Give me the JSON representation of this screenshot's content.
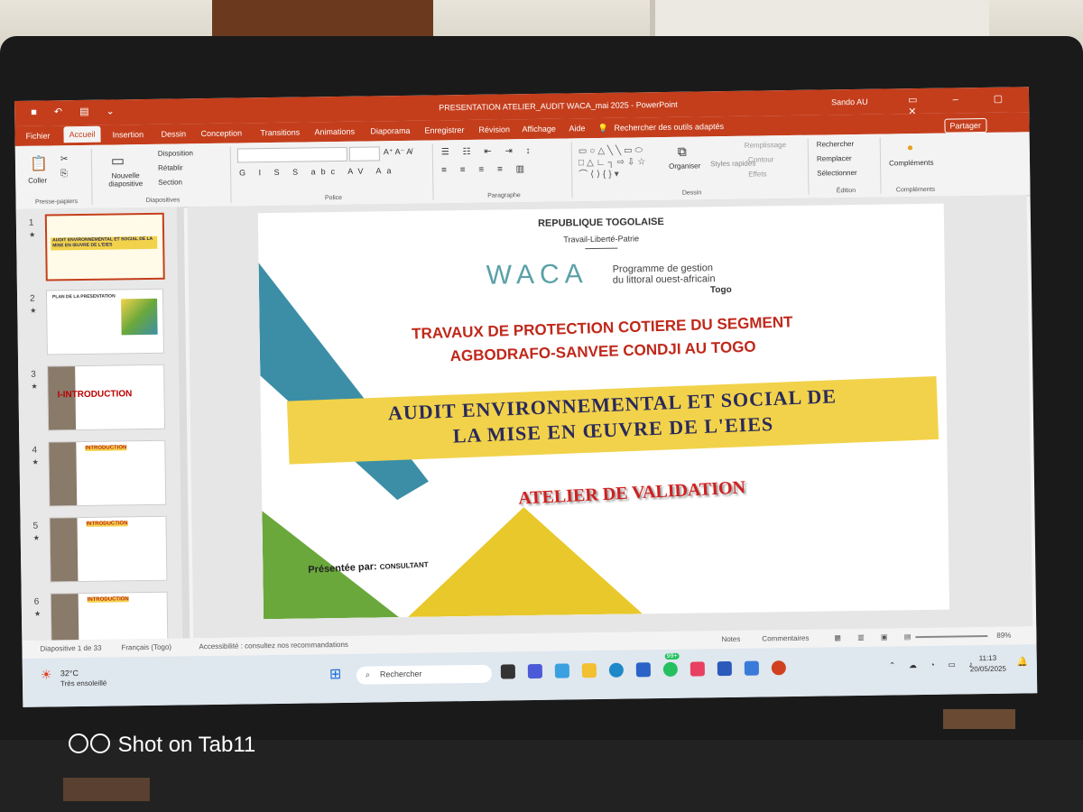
{
  "window": {
    "title": "PRESENTATION ATELIER_AUDIT WACA_mai 2025  -  PowerPoint",
    "user": "Sando AU"
  },
  "menu": {
    "tabs": [
      "Fichier",
      "Accueil",
      "Insertion",
      "Dessin",
      "Conception",
      "Transitions",
      "Animations",
      "Diaporama",
      "Enregistrer",
      "Révision",
      "Affichage",
      "Aide"
    ],
    "search": "Rechercher des outils adaptés",
    "share": "Partager"
  },
  "ribbon": {
    "paste": "Coller",
    "clipboard": "Presse-papiers",
    "new_slide": "Nouvelle diapositive",
    "disposition": "Disposition",
    "retablir": "Rétablir",
    "section": "Section",
    "slides_group": "Diapositives",
    "font_group": "Police",
    "paragraph_group": "Paragraphe",
    "arrange": "Organiser",
    "quick_styles": "Styles rapides",
    "fill": "Remplissage",
    "outline": "Contour",
    "effects": "Effets",
    "drawing_group": "Dessin",
    "find": "Rechercher",
    "replace": "Remplacer",
    "select": "Sélectionner",
    "editing_group": "Édition",
    "addins": "Compléments",
    "addins_group": "Compléments"
  },
  "thumbnails": [
    {
      "num": "1",
      "label": "AUDIT ENVIRONNEMENTAL ET SOCIAL DE LA MISE EN ŒUVRE DE L'EIES"
    },
    {
      "num": "2",
      "label": "PLAN DE LA PRESENTATION"
    },
    {
      "num": "3",
      "label": "I-INTRODUCTION"
    },
    {
      "num": "4",
      "label": "INTRODUCTION"
    },
    {
      "num": "5",
      "label": "INTRODUCTION"
    },
    {
      "num": "6",
      "label": "INTRODUCTION"
    }
  ],
  "slide": {
    "republic": "REPUBLIQUE TOGOLAISE",
    "motto": "Travail-Liberté-Patrie",
    "logo_text": "WACA",
    "logo_sub1": "Programme de gestion",
    "logo_sub2": "du littoral ouest-africain",
    "logo_country": "Togo",
    "title_line1": "TRAVAUX DE PROTECTION COTIERE DU SEGMENT",
    "title_line2": "AGBODRAFO-SANVEE CONDJI AU TOGO",
    "audit_line1": "AUDIT ENVIRONNEMENTAL ET SOCIAL DE",
    "audit_line2": "LA MISE EN ŒUVRE DE L'EIES",
    "atelier": "ATELIER DE VALIDATION",
    "presented_by": "Présentée par: ",
    "consultant": "CONSULTANT"
  },
  "statusbar": {
    "slide_count": "Diapositive 1 de 33",
    "language": "Français (Togo)",
    "accessibility": "Accessibilité : consultez nos recommandations",
    "notes": "Notes",
    "comments": "Commentaires",
    "zoom": "89%"
  },
  "taskbar": {
    "weather_temp": "32°C",
    "weather_desc": "Très ensoleillé",
    "search": "Rechercher",
    "badge": "99+",
    "time": "11:13",
    "date": "20/05/2025"
  },
  "watermark": "Shot on Tab11",
  "colors": {
    "ppt_red": "#c43e1c",
    "title_red": "#c0281a",
    "band_yellow": "#f2d24a",
    "navy": "#2a2a5a",
    "teal": "#3b8ea5",
    "green": "#6aa83c",
    "yellow_tri": "#e8c82a"
  }
}
